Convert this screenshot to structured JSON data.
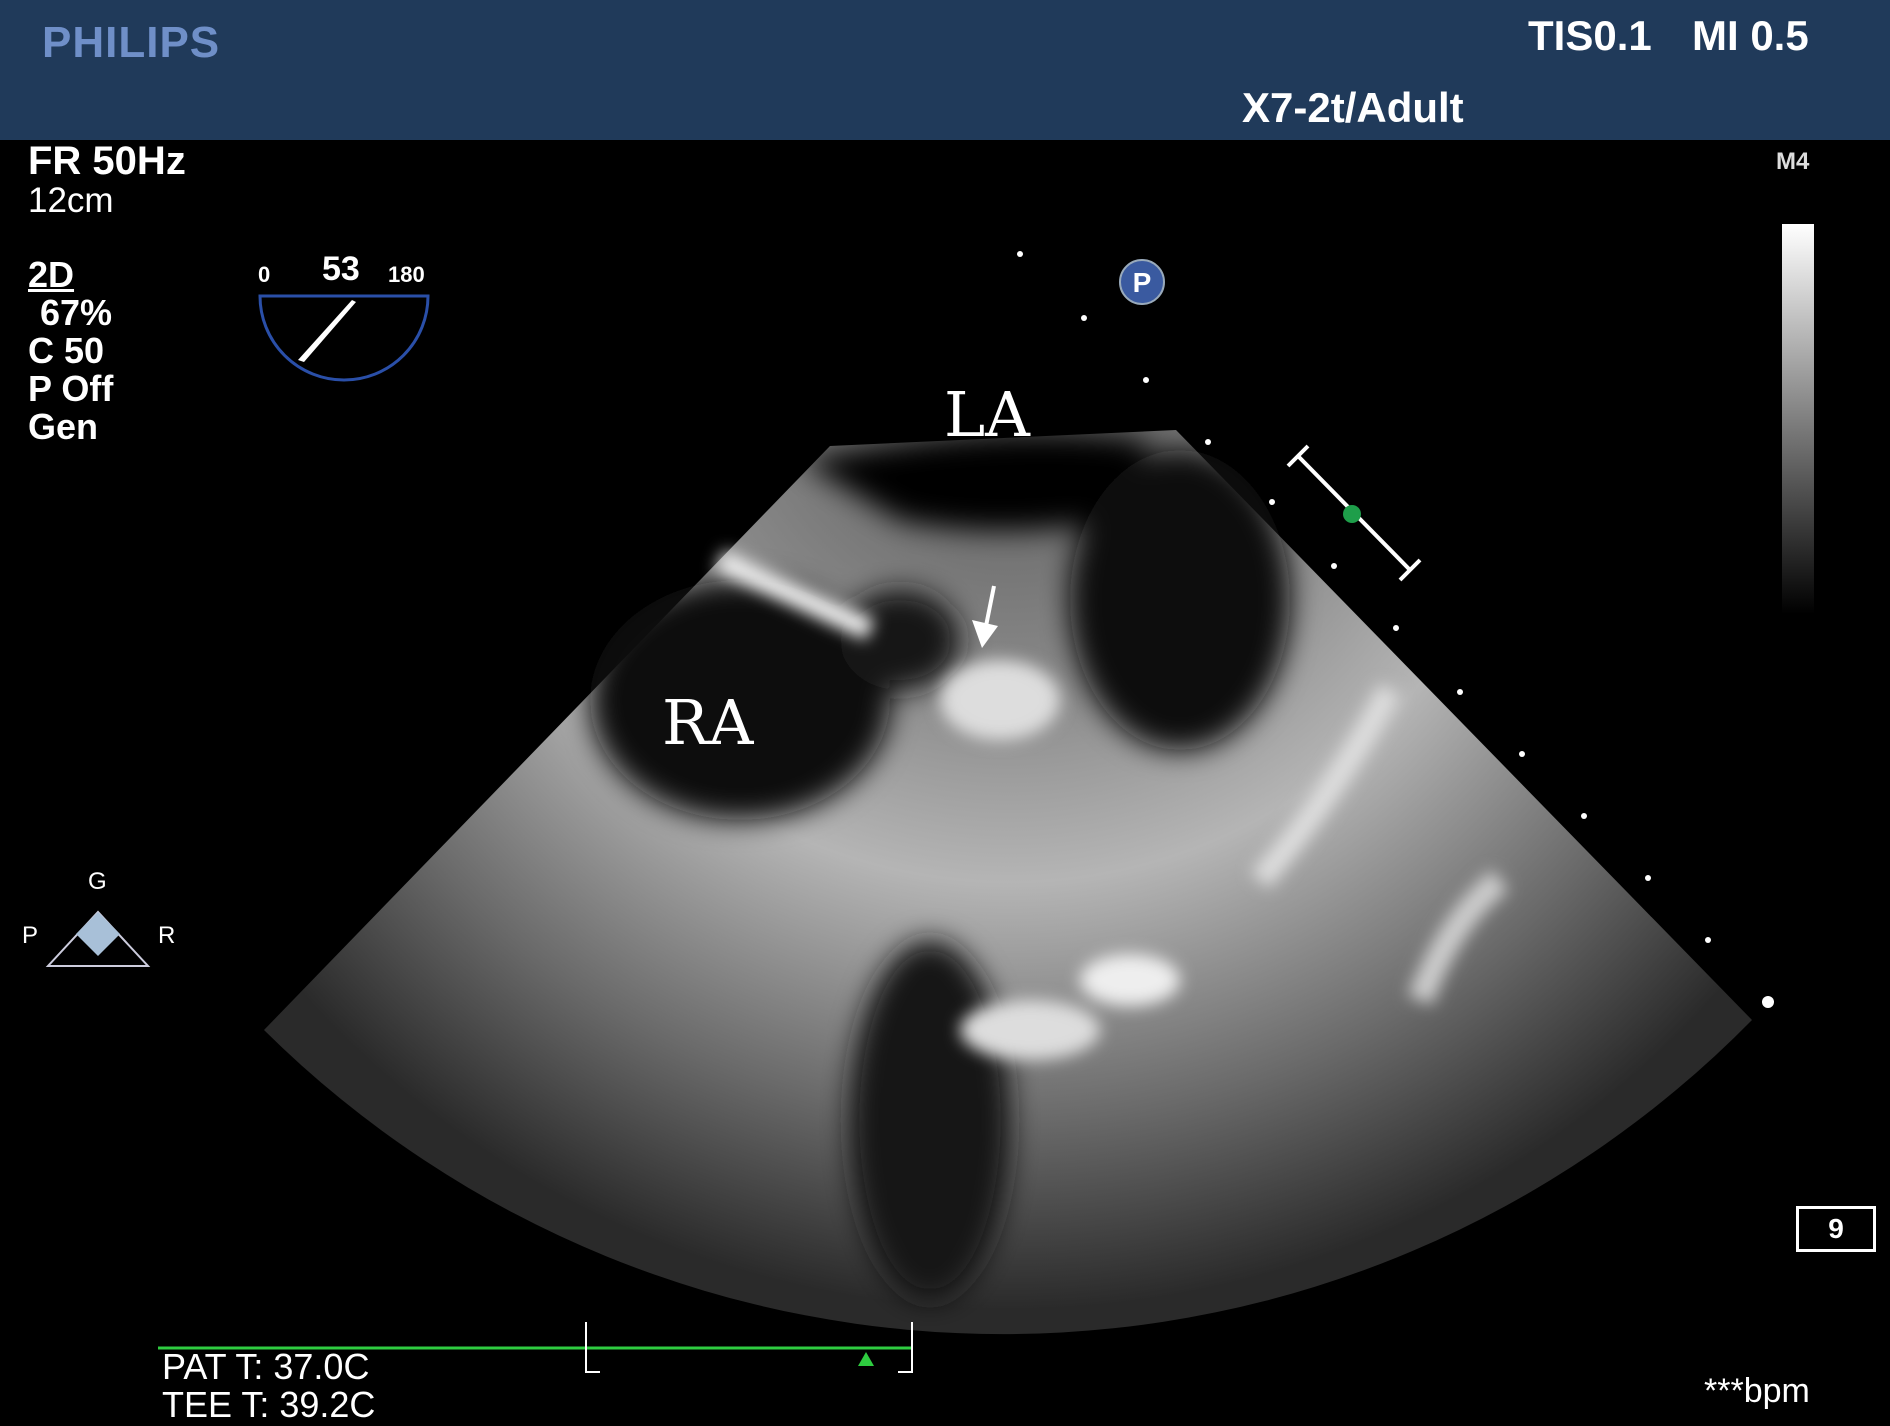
{
  "header": {
    "brand": "PHILIPS",
    "tis": "TIS0.1",
    "mi": "MI 0.5",
    "probe": "X7-2t/Adult"
  },
  "settings": {
    "frame_rate": "FR 50Hz",
    "depth": "12cm",
    "mode": "2D",
    "gain": "67%",
    "compress": "C 50",
    "persist": "P Off",
    "gen": "Gen"
  },
  "angle": {
    "min": "0",
    "value": "53",
    "max": "180"
  },
  "grayscale_label": "M4",
  "orientation": {
    "top": "G",
    "left": "P",
    "right": "R"
  },
  "labels": {
    "la": "LA",
    "ra": "RA"
  },
  "frame_box": "9",
  "footer": {
    "pat_temp": "PAT T: 37.0C",
    "tee_temp": "TEE T: 39.2C",
    "bpm": "***bpm"
  },
  "colors": {
    "header_bg": "#203a5a",
    "brand": "#6f8fc8",
    "ecg": "#2ecc40",
    "focus_marker": "#1e9e4a",
    "angle_arc": "#2a4fa8"
  },
  "icons": {
    "probe_marker": "p-circle-icon",
    "orientation": "diamond-triangle-icon",
    "annotation": "arrow-down-icon"
  }
}
